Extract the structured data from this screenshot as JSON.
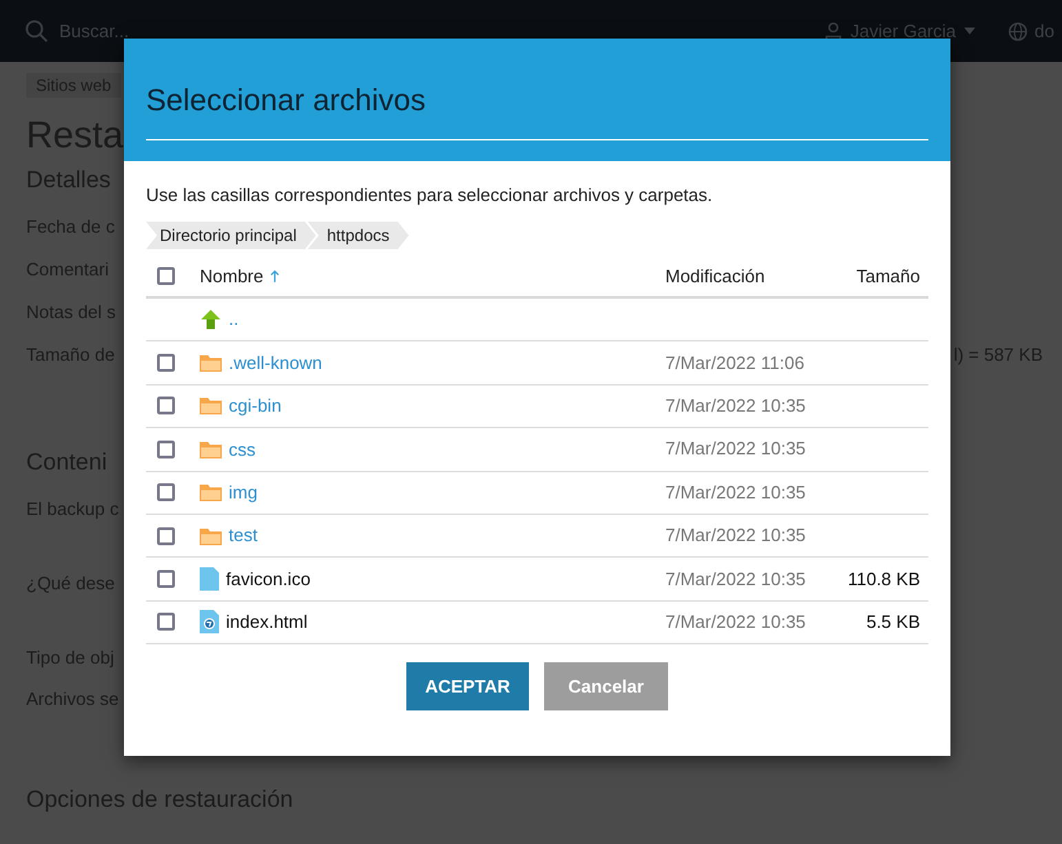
{
  "topbar": {
    "search": {
      "placeholder": "Buscar..."
    },
    "user": "Javier Garcia",
    "domain": "do"
  },
  "page": {
    "breadcrumb": "Sitios web",
    "title": "Resta",
    "sections": [
      {
        "heading": "Detalles",
        "rows": [
          {
            "label": "Fecha de c"
          },
          {
            "label": "Comentari"
          },
          {
            "label": "Notas del s"
          },
          {
            "label": "Tamaño de",
            "value": "l) = 587 KB"
          }
        ]
      },
      {
        "heading": "Conteni",
        "rows": [
          {
            "label": "El backup c"
          },
          {
            "label": "¿Qué dese"
          },
          {
            "label": "Tipo de obj"
          },
          {
            "label": "Archivos se"
          }
        ]
      },
      {
        "heading": "Opciones de restauración"
      }
    ]
  },
  "dialog": {
    "title": "Seleccionar archivos",
    "hint": "Use las casillas correspondientes para seleccionar archivos y carpetas.",
    "path": [
      "Directorio principal",
      "httpdocs"
    ],
    "columns": [
      {
        "label": "Nombre",
        "sorted": true
      },
      {
        "label": "Modificación"
      },
      {
        "label": "Tamaño"
      }
    ],
    "select_all": {
      "checked": false
    },
    "rows": [
      {
        "kind": "parent",
        "name": ".."
      },
      {
        "kind": "folder",
        "name": ".well-known",
        "modified": "7/Mar/2022 11:06",
        "checked": false
      },
      {
        "kind": "folder",
        "name": "cgi-bin",
        "modified": "7/Mar/2022 10:35",
        "checked": false
      },
      {
        "kind": "folder",
        "name": "css",
        "modified": "7/Mar/2022 10:35",
        "checked": false
      },
      {
        "kind": "folder",
        "name": "img",
        "modified": "7/Mar/2022 10:35",
        "checked": false
      },
      {
        "kind": "folder",
        "name": "test",
        "modified": "7/Mar/2022 10:35",
        "checked": false
      },
      {
        "kind": "binary",
        "name": "favicon.ico",
        "modified": "7/Mar/2022 10:35",
        "size": "110.8 KB",
        "checked": false
      },
      {
        "kind": "html",
        "name": "index.html",
        "modified": "7/Mar/2022 10:35",
        "size": "5.5 KB",
        "checked": false
      }
    ],
    "buttons": [
      {
        "kind": "primary",
        "label": "ACEPTAR"
      },
      {
        "kind": "secondary",
        "label": "Cancelar"
      }
    ]
  }
}
